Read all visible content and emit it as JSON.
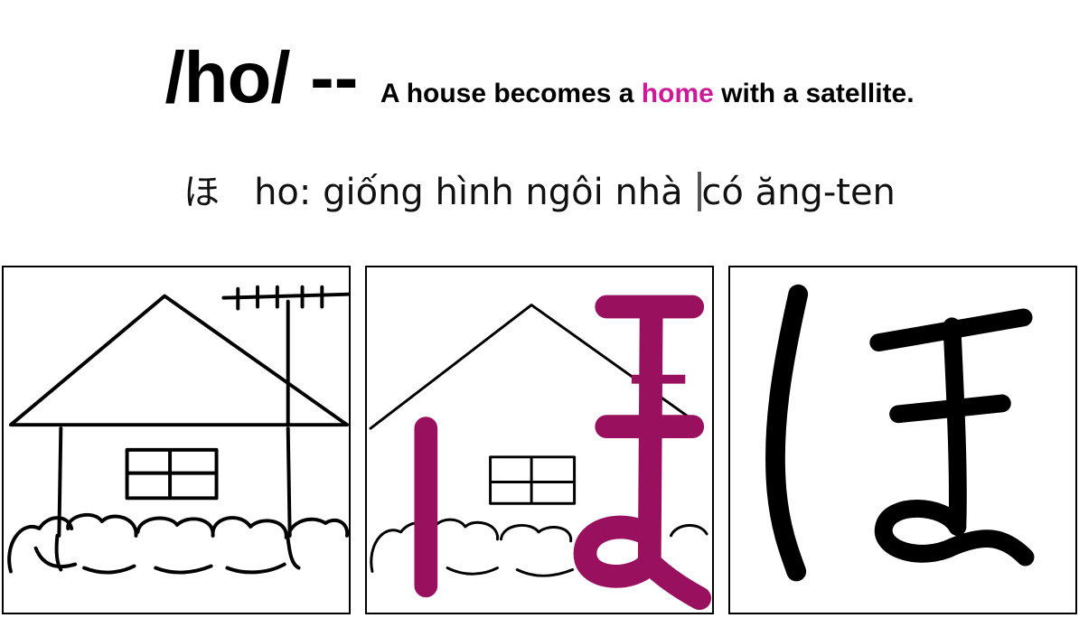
{
  "header": {
    "romaji": "/ho/",
    "separator": "--",
    "mnemonic_before": "A house becomes a ",
    "mnemonic_highlight": "home",
    "mnemonic_after": " with a satellite."
  },
  "subtitle": {
    "kana": "ほ",
    "text_before_cursor": "ho: giống hình ngôi nhà ",
    "text_after_cursor": "có ăng-ten"
  },
  "panels": {
    "big_kana": "ほ"
  },
  "colors": {
    "highlight": "#cc1a99",
    "stroke_overlay": "#99115e",
    "ink": "#000000"
  }
}
